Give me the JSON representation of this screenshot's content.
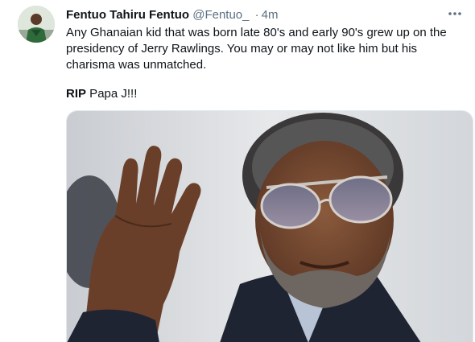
{
  "tweet": {
    "display_name": "Fentuo Tahiru Fentuo",
    "handle": "@Fentuo_",
    "separator": "·",
    "time": "4m",
    "text": "Any Ghanaian kid that was born late 80's and early 90's grew up on the presidency of Jerry Rawlings. You may or may not like him but his charisma was unmatched.",
    "rip_bold": "RIP",
    "rip_rest": " Papa J!!!",
    "more_icon": "more-horizontal-icon"
  },
  "colors": {
    "text_primary": "#0f1419",
    "text_secondary": "#5b7083",
    "border": "#e1e8ed"
  }
}
